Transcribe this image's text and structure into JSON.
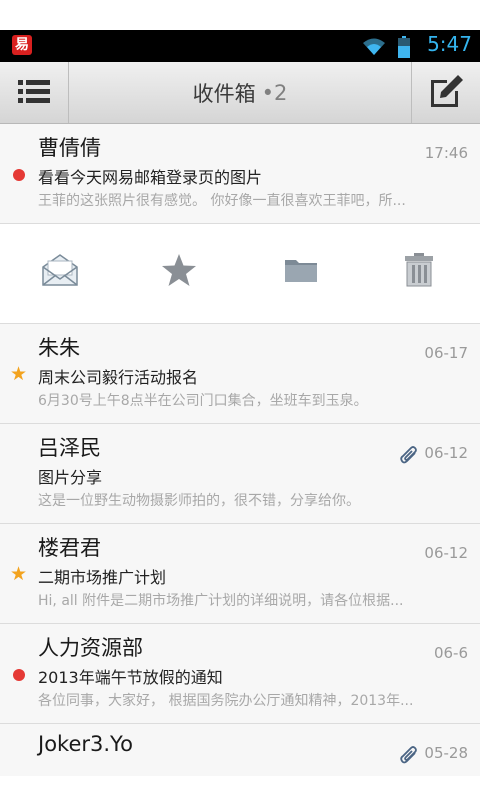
{
  "status_bar": {
    "app_icon": "netease-mail-icon",
    "app_icon_glyph": "易",
    "time": "5:47",
    "wifi_icon": "wifi-icon",
    "battery_icon": "battery-icon"
  },
  "toolbar": {
    "title": "收件箱",
    "unread": "•2",
    "menu_icon": "list-menu-icon",
    "compose_icon": "compose-icon"
  },
  "quick_actions": [
    "mark-read-icon",
    "star-icon",
    "folder-icon",
    "trash-icon"
  ],
  "mails": [
    {
      "sender": "曹倩倩",
      "date": "17:46",
      "subject": "看看今天网易邮箱登录页的图片",
      "preview": "王菲的这张照片很有感觉。 你好像一直很喜欢王菲吧，所...",
      "marker": "unread",
      "attachment": false
    },
    {
      "sender": "朱朱",
      "date": "06-17",
      "subject": "周末公司毅行活动报名",
      "preview": "6月30号上午8点半在公司门口集合，坐班车到玉泉。",
      "marker": "star",
      "attachment": false
    },
    {
      "sender": "吕泽民",
      "date": "06-12",
      "subject": "图片分享",
      "preview": "这是一位野生动物摄影师拍的，很不错，分享给你。",
      "marker": "none",
      "attachment": true
    },
    {
      "sender": "楼君君",
      "date": "06-12",
      "subject": "二期市场推广计划",
      "preview": "Hi, all 附件是二期市场推广计划的详细说明，请各位根据...",
      "marker": "star",
      "attachment": false
    },
    {
      "sender": "人力资源部",
      "date": "06-6",
      "subject": "2013年端午节放假的通知",
      "preview": "各位同事，大家好， 根据国务院办公厅通知精神，2013年...",
      "marker": "unread",
      "attachment": false
    },
    {
      "sender": "Joker3.Yo",
      "date": "05-28",
      "subject": "",
      "preview": "",
      "marker": "none",
      "attachment": true
    }
  ],
  "colors": {
    "unread_dot": "#e53935",
    "star": "#f3a31e",
    "clock": "#34b4ee"
  }
}
